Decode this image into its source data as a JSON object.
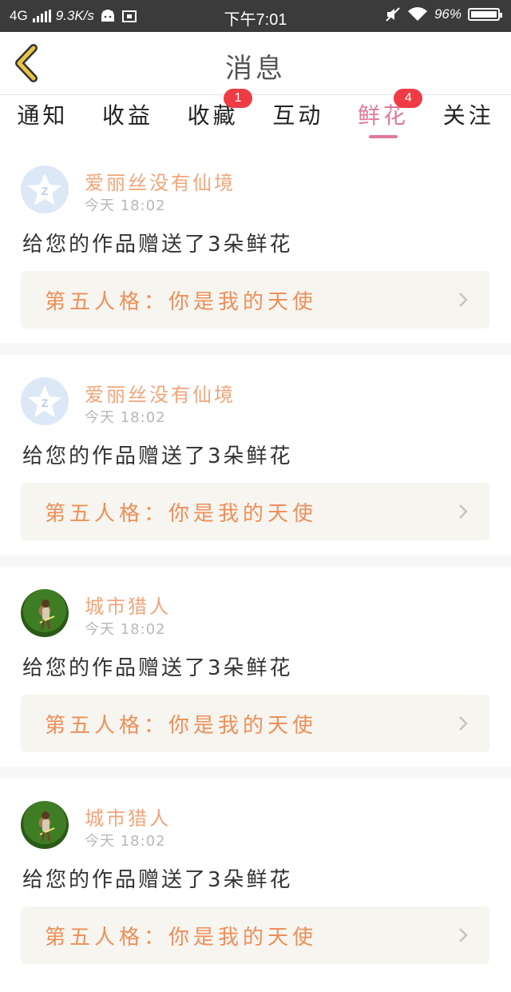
{
  "status_bar": {
    "network": "4G",
    "speed": "9.3K/s",
    "time": "下午7:01",
    "battery": "96%",
    "battery_level": 0.96
  },
  "header": {
    "title": "消息"
  },
  "tabs": [
    {
      "label": "通知",
      "badge": ""
    },
    {
      "label": "收益",
      "badge": ""
    },
    {
      "label": "收藏",
      "badge": "1"
    },
    {
      "label": "互动",
      "badge": ""
    },
    {
      "label": "鲜花",
      "badge": "4",
      "active": true
    },
    {
      "label": "关注",
      "badge": ""
    }
  ],
  "messages": [
    {
      "user": "爱丽丝没有仙境",
      "time": "今天 18:02",
      "text": "给您的作品赠送了3朵鲜花",
      "work": "第五人格：你是我的天使",
      "avatar": "qq-default-avatar"
    },
    {
      "user": "爱丽丝没有仙境",
      "time": "今天 18:02",
      "text": "给您的作品赠送了3朵鲜花",
      "work": "第五人格：你是我的天使",
      "avatar": "qq-default-avatar"
    },
    {
      "user": "城市猎人",
      "time": "今天 18:02",
      "text": "给您的作品赠送了3朵鲜花",
      "work": "第五人格：你是我的天使",
      "avatar": "game-character-avatar"
    },
    {
      "user": "城市猎人",
      "time": "今天 18:02",
      "text": "给您的作品赠送了3朵鲜花",
      "work": "第五人格：你是我的天使",
      "avatar": "game-character-avatar"
    }
  ],
  "colors": {
    "accent": "#e0789a",
    "username": "#f0a57a",
    "work_title": "#ee8f5a",
    "badge": "#ee3b44",
    "back_arrow": "#e8c447"
  }
}
